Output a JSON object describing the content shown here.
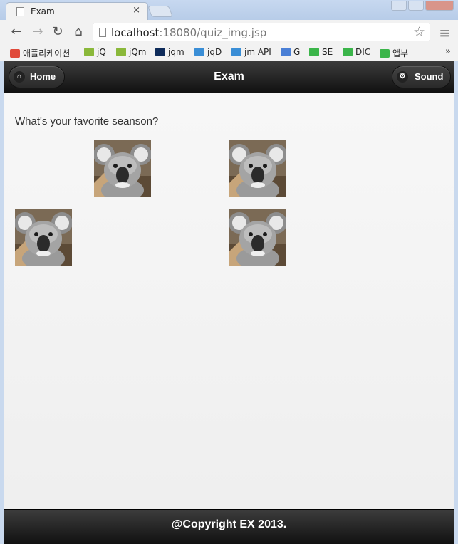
{
  "browser": {
    "tab_title": "Exam",
    "tab_close": "×",
    "url_host": "localhost",
    "url_rest": ":18080/quiz_img.jsp",
    "bookmarks": [
      {
        "label": "애플리케이션",
        "icon": "apps-grid-icon",
        "color": "#e04a3a"
      },
      {
        "label": "jQ",
        "icon": "w3-icon",
        "color": "#8ab83a"
      },
      {
        "label": "jQm",
        "icon": "w3-icon",
        "color": "#8ab83a"
      },
      {
        "label": "jqm",
        "icon": "jquery-icon",
        "color": "#0e2b5a"
      },
      {
        "label": "jqD",
        "icon": "jquery-doc-icon",
        "color": "#3a8ed6"
      },
      {
        "label": "jm API",
        "icon": "jquery-doc-icon",
        "color": "#3a8ed6"
      },
      {
        "label": "G",
        "icon": "google-icon",
        "color": "#4a7fd6"
      },
      {
        "label": "SE",
        "icon": "bookmark-box-icon",
        "color": "#3bb54a"
      },
      {
        "label": "DIC",
        "icon": "bookmark-box-icon",
        "color": "#3bb54a"
      },
      {
        "label": "앱부",
        "icon": "bookmark-box-icon",
        "color": "#3bb54a"
      }
    ],
    "more": "»"
  },
  "page": {
    "header_title": "Exam",
    "home_label": "Home",
    "sound_label": "Sound",
    "question": "What's your favorite seanson?",
    "options": [
      {
        "name": "koala-image-1"
      },
      {
        "name": "koala-image-2"
      },
      {
        "name": "koala-image-3"
      },
      {
        "name": "koala-image-4"
      }
    ],
    "footer": "@Copyright EX 2013."
  }
}
